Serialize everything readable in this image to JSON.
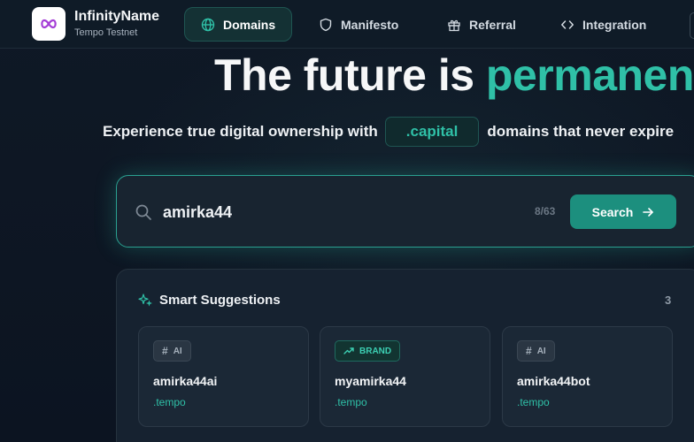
{
  "nav": {
    "brand_name": "InfinityName",
    "brand_sub": "Tempo Testnet",
    "items": [
      {
        "label": "Domains",
        "icon": "globe-icon",
        "active": true
      },
      {
        "label": "Manifesto",
        "icon": "shield-icon",
        "active": false
      },
      {
        "label": "Referral",
        "icon": "gift-icon",
        "active": false
      },
      {
        "label": "Integration",
        "icon": "code-icon",
        "active": false
      }
    ]
  },
  "hero": {
    "title_main": "The future is ",
    "title_accent": "permanent",
    "subline_before": "Experience true digital ownership with",
    "tld_chip": ".capital",
    "subline_after": "domains that never expire"
  },
  "search": {
    "value": "amirka44",
    "char_count": "8/63",
    "button_label": "Search"
  },
  "suggestions": {
    "title": "Smart Suggestions",
    "count": "3",
    "items": [
      {
        "badge": "AI",
        "badge_icon": "hash-icon",
        "name": "amirka44ai",
        "tld": ".tempo"
      },
      {
        "badge": "BRAND",
        "badge_icon": "trending-up-icon",
        "name": "myamirka44",
        "tld": ".tempo"
      },
      {
        "badge": "AI",
        "badge_icon": "hash-icon",
        "name": "amirka44bot",
        "tld": ".tempo"
      }
    ]
  },
  "colors": {
    "accent": "#2fc0a7",
    "background": "#0d1522",
    "button": "#1c8f7e",
    "logo_glyph": "#a43dd6"
  }
}
